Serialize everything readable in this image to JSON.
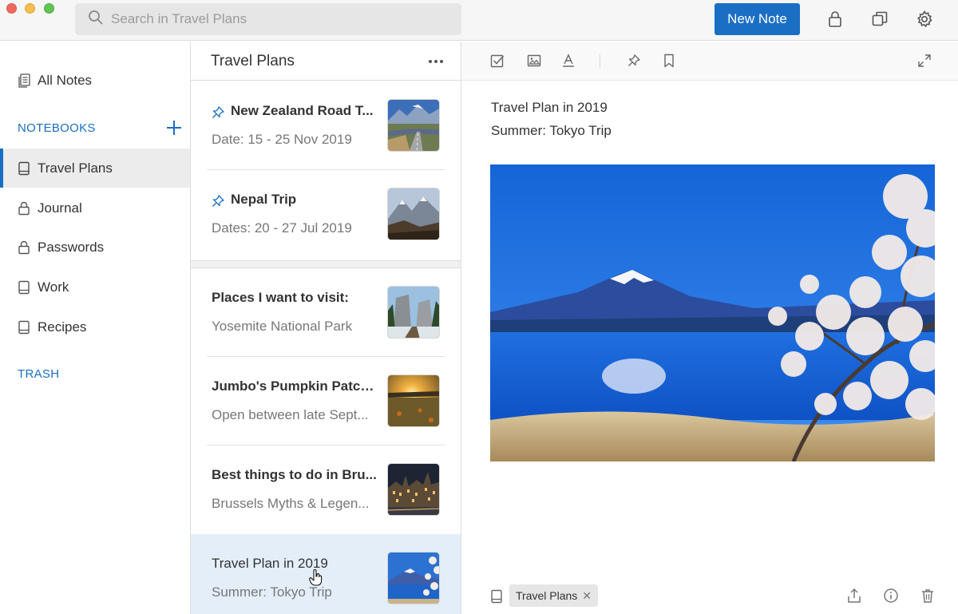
{
  "search": {
    "placeholder": "Search in Travel Plans"
  },
  "header": {
    "new_note_label": "New Note"
  },
  "sidebar": {
    "all_notes": "All Notes",
    "notebooks_heading": "NOTEBOOKS",
    "notebooks": [
      {
        "label": "Travel Plans",
        "icon": "notebook-icon",
        "active": true
      },
      {
        "label": "Journal",
        "icon": "lock-icon"
      },
      {
        "label": "Passwords",
        "icon": "lock-icon"
      },
      {
        "label": "Work",
        "icon": "notebook-icon"
      },
      {
        "label": "Recipes",
        "icon": "notebook-icon"
      }
    ],
    "trash_heading": "TRASH"
  },
  "note_list": {
    "title": "Travel Plans",
    "notes": [
      {
        "title": "New Zealand Road T...",
        "subtitle": "Date: 15 - 25 Nov 2019",
        "pinned": true
      },
      {
        "title": "Nepal Trip",
        "subtitle": "Dates: 20 - 27 Jul 2019",
        "pinned": true
      },
      {
        "title": "Places I want to visit:",
        "subtitle": "Yosemite National Park",
        "pinned": false
      },
      {
        "title": "Jumbo's Pumpkin Patch...",
        "subtitle": "Open between late Sept...",
        "pinned": false
      },
      {
        "title": "Best things to do in Bru...",
        "subtitle": "Brussels Myths & Legen...",
        "pinned": false
      },
      {
        "title": "Travel Plan in 2019",
        "subtitle": "Summer: Tokyo Trip",
        "pinned": false,
        "selected": true
      }
    ]
  },
  "editor": {
    "line1": "Travel Plan in 2019",
    "line2": "Summer: Tokyo Trip",
    "tag": "Travel Plans"
  },
  "colors": {
    "accent": "#1a6fc4",
    "selected_bg": "#e3eef9"
  }
}
